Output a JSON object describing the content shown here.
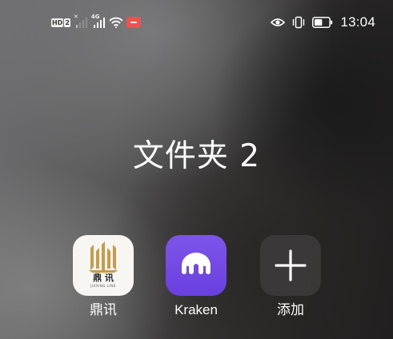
{
  "status_bar": {
    "left": {
      "hd_label": "HD",
      "hd_sim": "2",
      "sim2_mini": "4G",
      "icons": [
        "hd-2-icon",
        "signal-no-service-icon",
        "signal-4g-icon",
        "wifi-icon",
        "recording-icon"
      ]
    },
    "right": {
      "icons": [
        "eye-comfort-icon",
        "vibrate-icon",
        "battery-icon"
      ],
      "battery_level_fraction": 0.55,
      "time": "13:04"
    }
  },
  "folder": {
    "title": "文件夹 2"
  },
  "apps": [
    {
      "label": "鼎讯",
      "icon": "dingxun-app-icon",
      "icon_text": "鼎 讯",
      "icon_subtext": "JIAXING LINK",
      "accent": "#c89b4a"
    },
    {
      "label": "Kraken",
      "icon": "kraken-app-icon",
      "accent": "#7132f5"
    },
    {
      "label": "添加",
      "icon": "plus-icon"
    }
  ]
}
